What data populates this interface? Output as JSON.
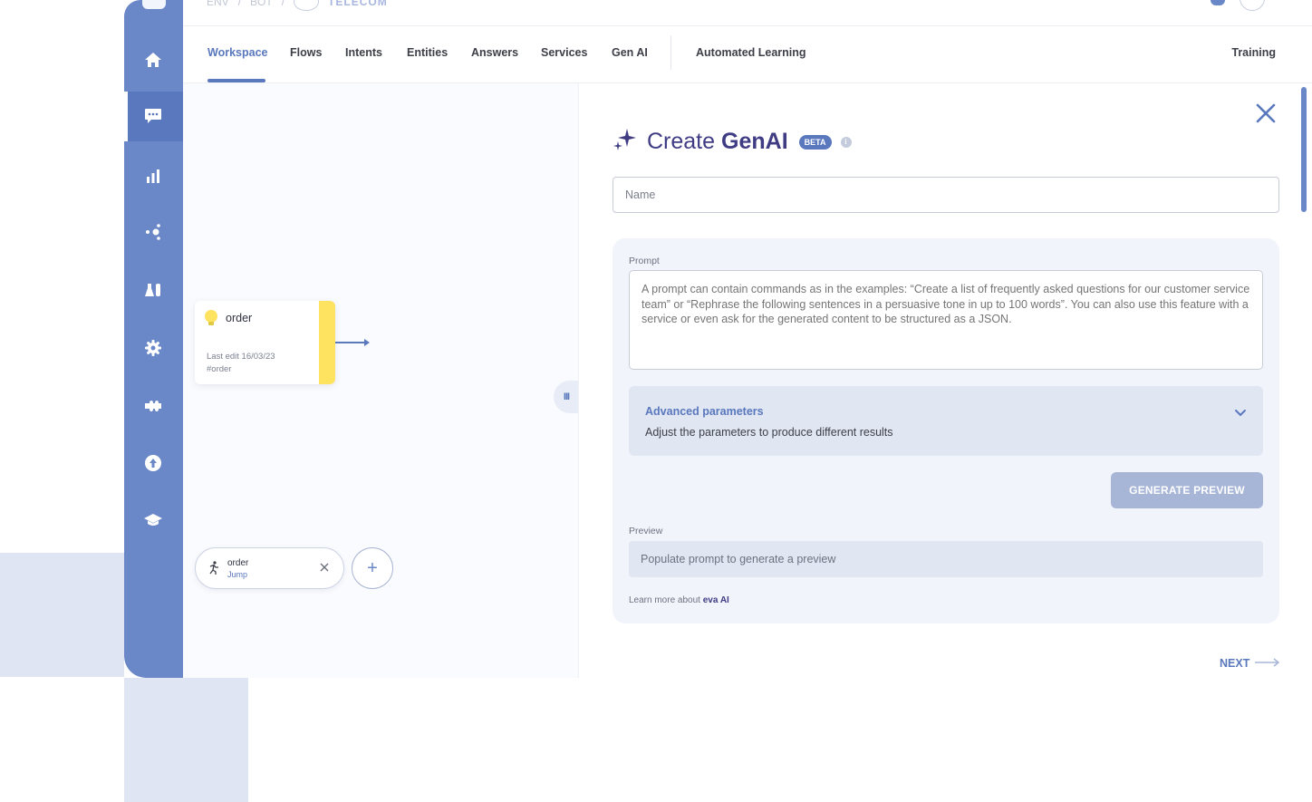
{
  "breadcrumbs": {
    "org": "ENV",
    "bot": "BOT",
    "project": "TELECOM"
  },
  "tabs": [
    {
      "label": "Workspace",
      "active": true
    },
    {
      "label": "Flows"
    },
    {
      "label": "Intents"
    },
    {
      "label": "Entities"
    },
    {
      "label": "Answers"
    },
    {
      "label": "Services"
    },
    {
      "label": "Gen AI"
    },
    {
      "label": "Automated Learning"
    },
    {
      "label": "Training"
    }
  ],
  "sidebar": {
    "items": [
      {
        "icon": "home-icon"
      },
      {
        "icon": "chat-icon",
        "active": true
      },
      {
        "icon": "bar-chart-icon"
      },
      {
        "icon": "network-icon"
      },
      {
        "icon": "lab-icon"
      },
      {
        "icon": "gear-icon"
      },
      {
        "icon": "puzzle-icon"
      },
      {
        "icon": "upload-icon"
      },
      {
        "icon": "graduation-cap-icon"
      }
    ]
  },
  "canvas": {
    "intent_card": {
      "title": "order",
      "last_edit": "Last edit 16/03/23",
      "tag": "#order"
    },
    "jump_node": {
      "title": "order",
      "subtitle": "Jump"
    },
    "add_symbol": "+",
    "handle_symbol": "III"
  },
  "panel": {
    "title_prefix": "Create",
    "title_strong": "GenAI",
    "badge": "BETA",
    "name_placeholder": "Name",
    "prompt_label": "Prompt",
    "prompt_text": "A prompt can contain commands as in the examples: “Create a list of frequently asked questions for our customer service team” or “Rephrase the following sentences in a persuasive tone in up to 100 words”. You can also use this feature with a service or even ask for the generated content to be structured as a JSON.",
    "advanced_title": "Advanced parameters",
    "advanced_subtitle": "Adjust the parameters to produce different results",
    "generate_button": "GENERATE PREVIEW",
    "preview_label": "Preview",
    "preview_placeholder": "Populate prompt to generate a preview",
    "learn_more_prefix": "Learn more about",
    "learn_more_link": "eva AI",
    "next_button": "NEXT"
  },
  "colors": {
    "accent": "#5a78bd",
    "sidebar": "#6a87c7",
    "title": "#3f3c84",
    "intent": "#fde35f"
  }
}
